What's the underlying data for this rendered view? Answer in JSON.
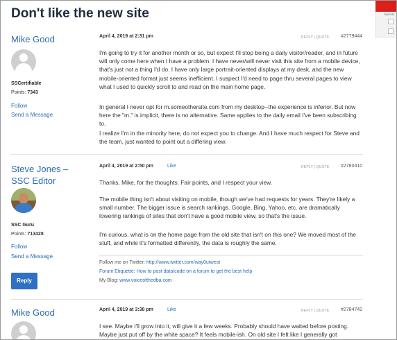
{
  "page": {
    "title": "Don't like the new site"
  },
  "posts": [
    {
      "author": "Mike Good",
      "role": "SSCertifiable",
      "points_label": "Points:",
      "points": "7343",
      "follow": "Follow",
      "send_message": "Send a Message",
      "date": "April 4, 2019 at 2:31 pm",
      "like": "",
      "reply_quote": "REPLY | QUOTE",
      "post_id": "#2779444",
      "paragraphs": [
        "I'm going to try it for another month or so, but expect I'll stop being a daily visitor/reader, and in future will only come here when I have a problem.  I have never/will never visit this site from a mobile device, that's just not a thing I'd do.  I have only large portrait-oriented displays at my desk, and the new mobile-oriented format just seems inefficient.  I suspect I'd need to page thru several pages to view what I used to quickly scroll to and read on the main home page.",
        "In general I never opt for m.someothersite.com from my desktop--the experience is inferior.  But now here the \"m.\" is implicit, there is no alternative.  Same applies to the daily email I've been subscribing to.",
        "I realize I'm in the minority here, do not expect you to change.  And I have much respect for Steve and the team, just wanted to point out a differing view."
      ]
    },
    {
      "author": "Steve Jones – SSC Editor",
      "role": "SSC Guru",
      "points_label": "Points:",
      "points": "713428",
      "follow": "Follow",
      "send_message": "Send a Message",
      "reply_button": "Reply",
      "date": "April 4, 2019 at 2:50 pm",
      "like": "Like",
      "reply_quote": "REPLY | QUOTE",
      "post_id": "#2780410",
      "paragraphs": [
        "Thanks, Mike, for the thoughts. Fair points, and I respect your view.",
        "The mobile thing isn't about visiting on mobile, though we've had requests for years. They're likely a small number. The bigger issue is search rankings. Google, Bing, Yahoo, etc. are dramatically lowering rankings of sites that don't have a good mobile view, so that's the issue.",
        "I'm curious, what is on the home page from the old site that isn't on this one? We moved most of the stuff, and while it's formatted differently, the data is roughly the same."
      ],
      "signature": {
        "twitter_prefix": "Follow me on Twitter: ",
        "twitter_link": "http://www.twitter.com/way0utwest",
        "etiquette": "Forum Etiquette: How to post data/code on a forum to get the best help",
        "blog_prefix": "My Blog: ",
        "blog_link": "www.voiceofthedba.com"
      }
    },
    {
      "author": "Mike Good",
      "date": "April 4, 2019 at 3:38 pm",
      "like": "Like",
      "reply_quote": "REPLY | QUOTE",
      "post_id": "#2784742",
      "paragraphs": [
        "I see.  Maybe I'll grow into it, will give it a few weeks.  Probably should have waited before posting.  Maybe just put off by the white space?  It feels mobile-ish.  On old site I felt like I generally got"
      ]
    }
  ],
  "corner_widget": {
    "label": "SQLGAL"
  },
  "colors": {
    "link": "#2a6db5",
    "button": "#2f6fc4",
    "title": "#1f2d3d"
  }
}
